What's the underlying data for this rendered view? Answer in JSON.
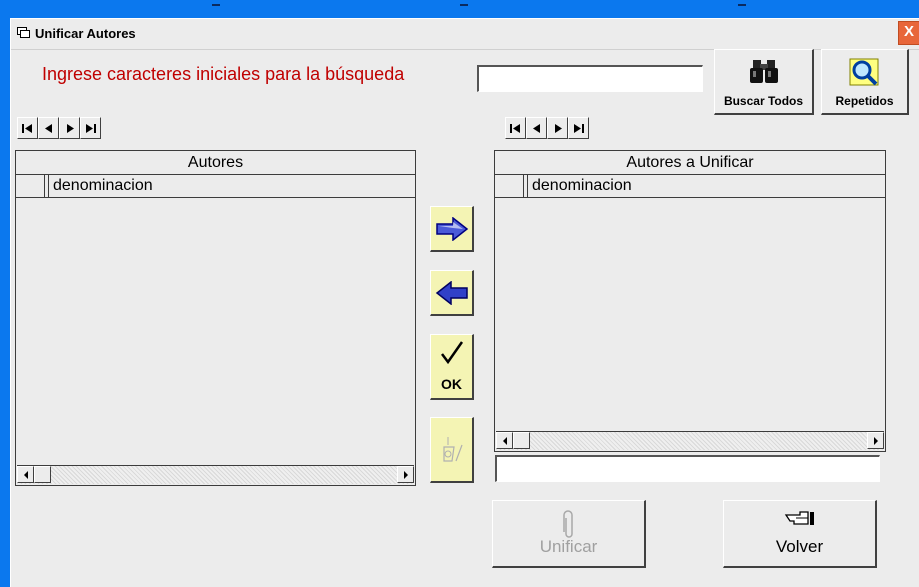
{
  "window": {
    "title": "Unificar Autores",
    "close_glyph": "X"
  },
  "search": {
    "prompt": "Ingrese caracteres iniciales para la búsqueda",
    "value": ""
  },
  "toolbar": {
    "buscar_todos_label": "Buscar Todos",
    "repetidos_label": "Repetidos"
  },
  "left_grid": {
    "title": "Autores",
    "column": "denominacion"
  },
  "right_grid": {
    "title": "Autores a Unificar",
    "column": "denominacion"
  },
  "middle": {
    "ok_label": "OK"
  },
  "actions": {
    "unificar_label": "Unificar",
    "volver_label": "Volver"
  },
  "colors": {
    "desktop": "#0b78ee",
    "prompt": "#c00000",
    "accent_button": "#f4f4b4",
    "disabled_text": "#a0a0a0"
  },
  "icons": {
    "buscar_todos": "binoculars-icon",
    "repetidos": "magnifier-icon",
    "add": "arrow-right-icon",
    "remove": "arrow-left-icon",
    "ok": "checkmark-icon",
    "clear": "eraser-icon",
    "unificar": "paperclip-icon",
    "volver": "pointing-hand-icon"
  }
}
